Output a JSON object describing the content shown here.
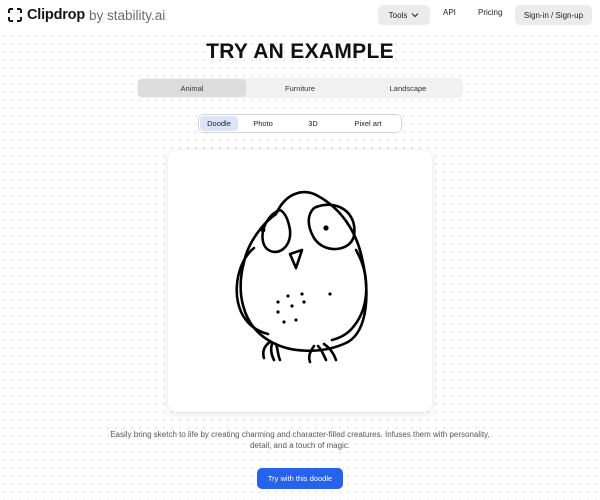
{
  "header": {
    "logo_text": "Clipdrop",
    "logo_suffix": "by stability.ai",
    "tools_label": "Tools",
    "api_label": "API",
    "pricing_label": "Pricing",
    "signin_label": "Sign-in / Sign-up"
  },
  "title": "TRY AN EXAMPLE",
  "categories": {
    "items": [
      "Animal",
      "Furniture",
      "Landscape"
    ],
    "selected": "Animal"
  },
  "styles": {
    "items": [
      "Doodle",
      "Photo",
      "3D",
      "Pixel art"
    ],
    "selected": "Doodle"
  },
  "example_image": "owl doodle sketch",
  "description": "Easily bring sketch to life by creating charming and character-filled creatures. Infuses them with personality, detail, and a touch of magic.",
  "cta_label": "Try with this doodle",
  "colors": {
    "accent": "#2563eb",
    "selected_tab": "#dcdcdc",
    "selected_style": "#dbe3f6"
  }
}
